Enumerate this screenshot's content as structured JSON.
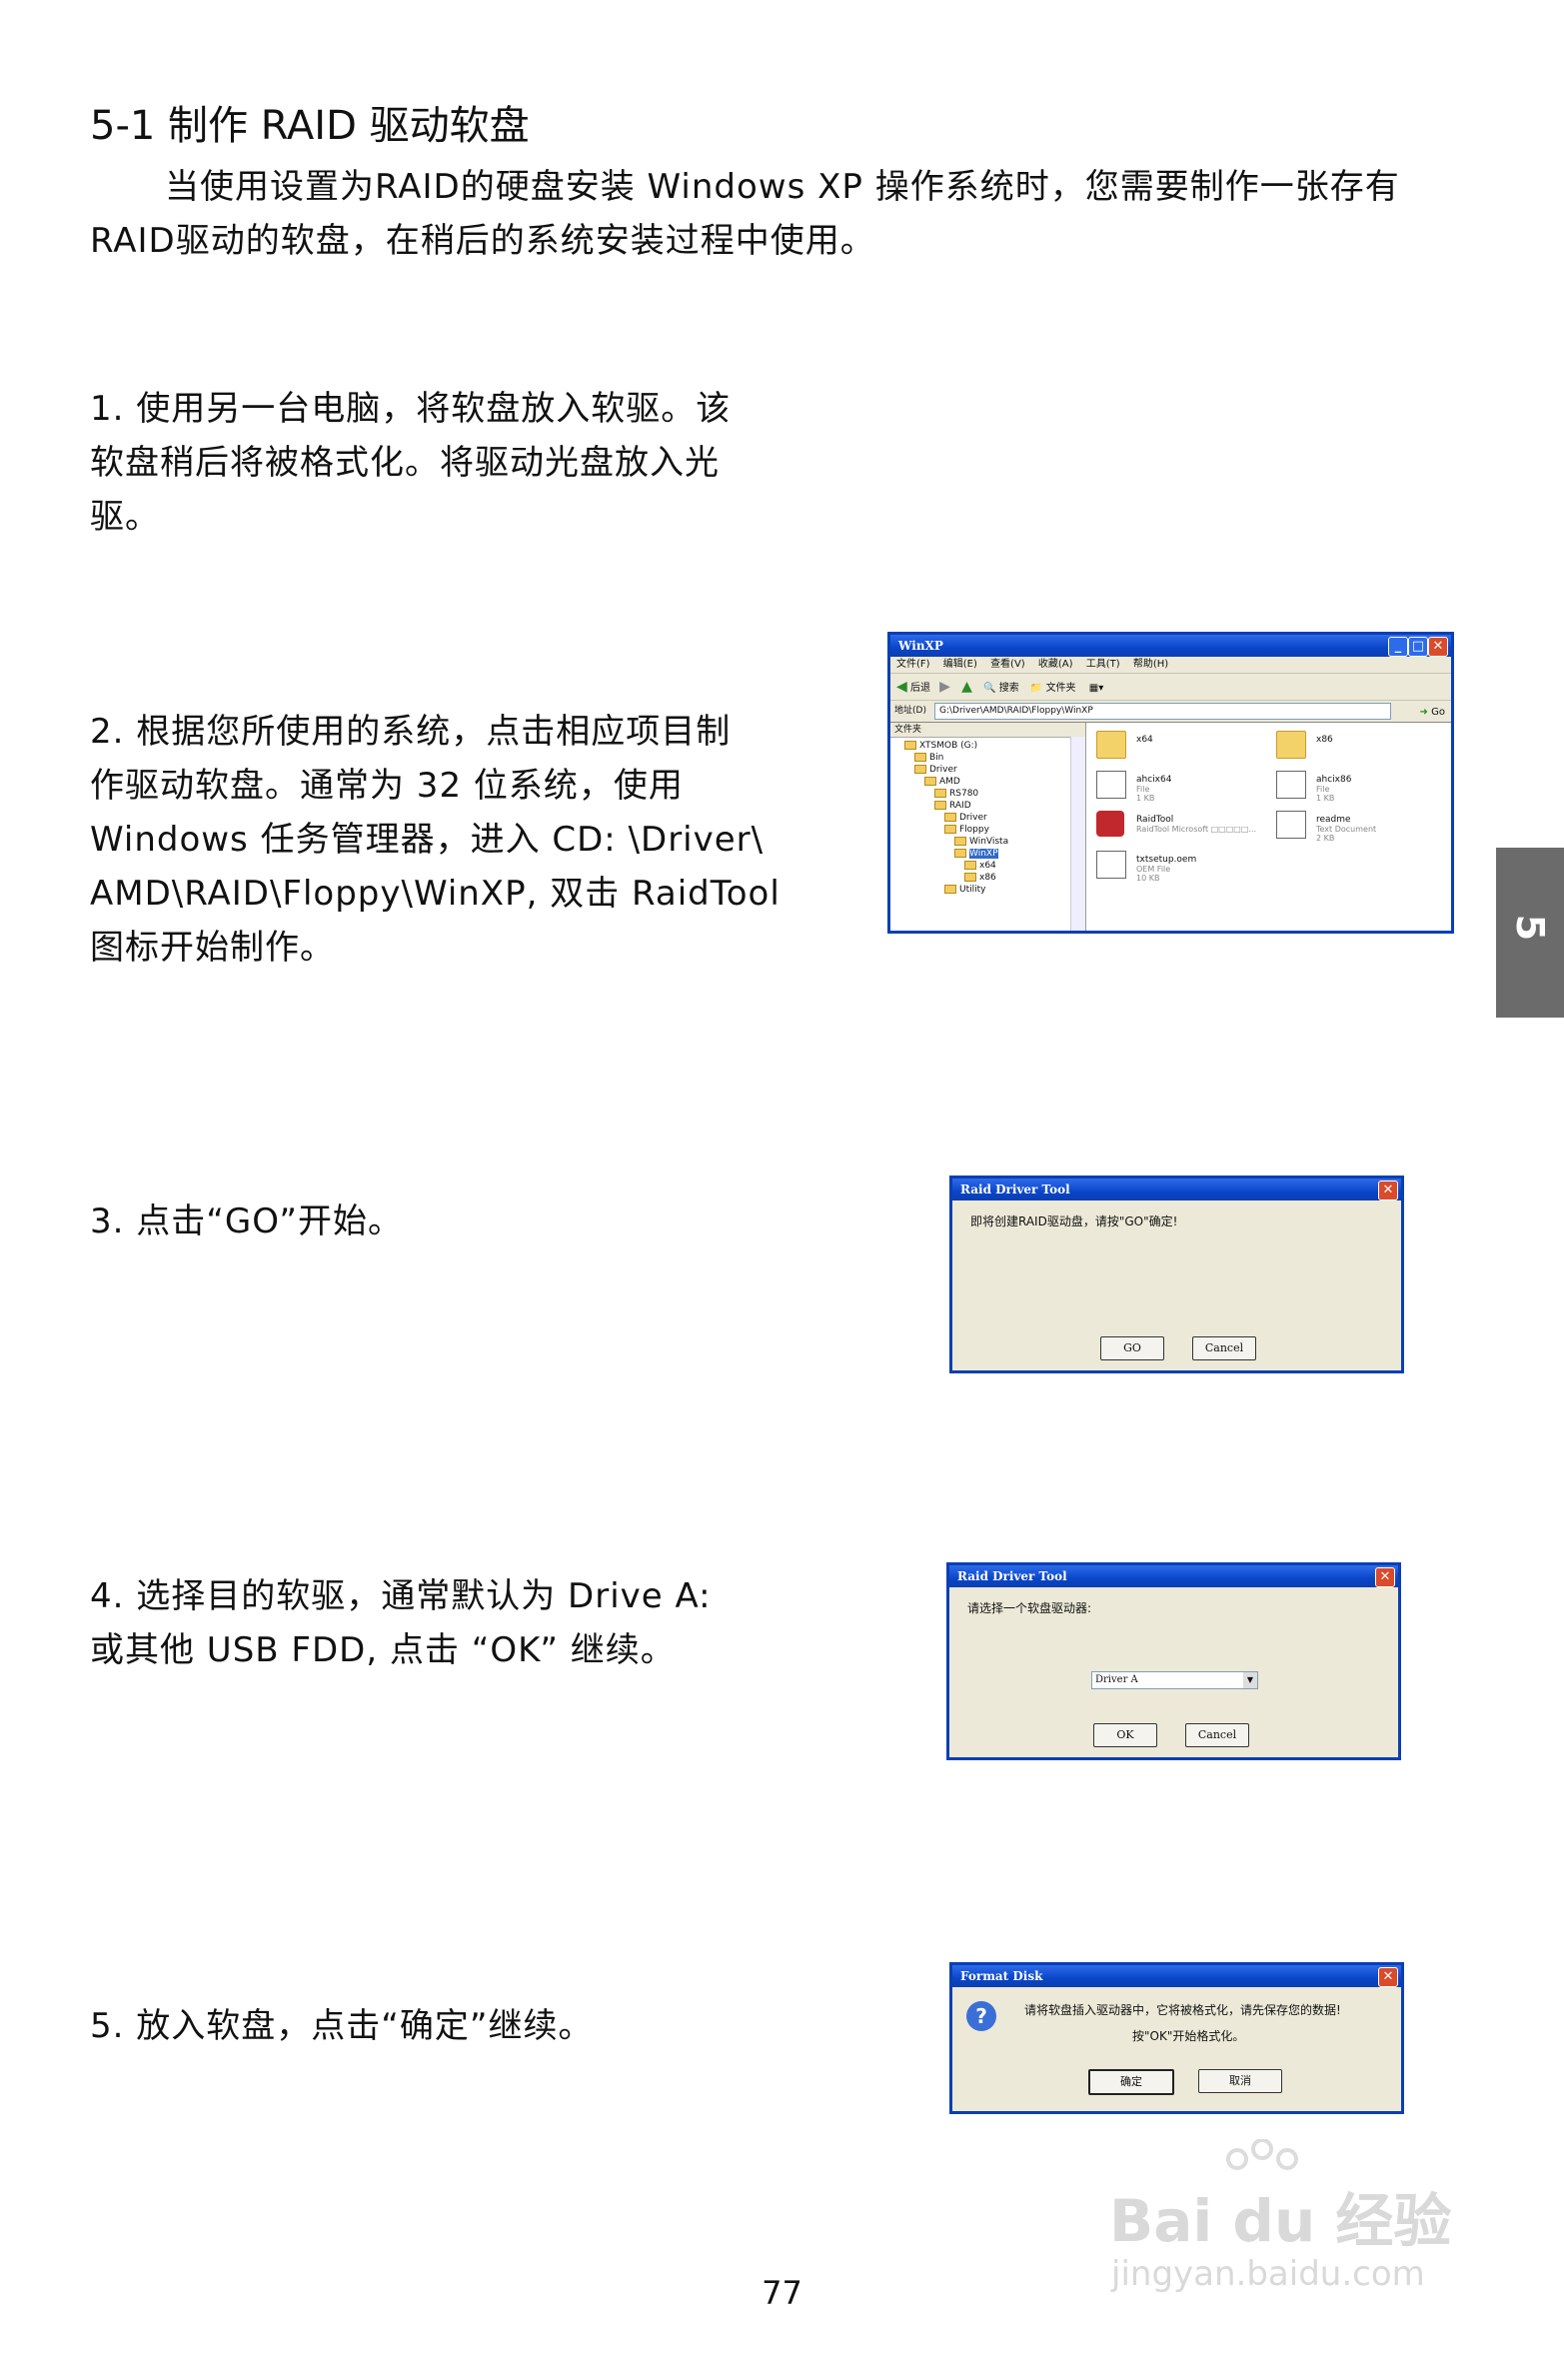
{
  "heading": "5-1 制作 RAID 驱动软盘",
  "intro": {
    "line1": "当使用设置为RAID的硬盘安装 Windows XP  操作系统时，您需要制作一张存有",
    "line2": "RAID驱动的软盘，在稍后的系统安装过程中使用。"
  },
  "steps": [
    {
      "lines": [
        "1.  使用另一台电脑，将软盘放入软驱。该",
        "软盘稍后将被格式化。将驱动光盘放入光",
        "驱。"
      ]
    },
    {
      "lines": [
        "2. 根据您所使用的系统，点击相应项目制",
        "作驱动软盘。通常为  32  位系统，使用",
        "Windows  任务管理器，进入  CD: \\Driver\\",
        "AMD\\RAID\\Floppy\\WinXP, 双击  RaidTool",
        "图标开始制作。"
      ]
    },
    {
      "lines": [
        "3. 点击“GO”开始。"
      ]
    },
    {
      "lines": [
        "4.  选择目的软驱，通常默认为  Drive  A:",
        "或其他  USB  FDD, 点击  “OK”  继续。"
      ]
    },
    {
      "lines": [
        "5. 放入软盘，点击“确定”继续。"
      ]
    }
  ],
  "side_tab": "5",
  "page_number": "77",
  "explorer": {
    "title": "WinXP",
    "menu": [
      "文件(F)",
      "编辑(E)",
      "查看(V)",
      "收藏(A)",
      "工具(T)",
      "帮助(H)"
    ],
    "toolbar": [
      "后退",
      "搜索",
      "文件夹"
    ],
    "address_label": "地址(D)",
    "address": "G:\\Driver\\AMD\\RAID\\Floppy\\WinXP",
    "go": "Go",
    "tree_header": "文件夹",
    "tree": [
      "XTSMOB (G:)",
      "Bin",
      "Driver",
      "AMD",
      "RS780",
      "RAID",
      "Driver",
      "Floppy",
      "WinVista",
      "WinXP",
      "x64",
      "x86",
      "Utility"
    ],
    "files": [
      {
        "name": "x64",
        "sub": ""
      },
      {
        "name": "x86",
        "sub": ""
      },
      {
        "name": "ahcix64",
        "sub": "File|1 KB"
      },
      {
        "name": "ahcix86",
        "sub": "File|1 KB"
      },
      {
        "name": "RaidTool",
        "sub": "RaidTool Microsoft □□□□□..."
      },
      {
        "name": "readme",
        "sub": "Text Document|2 KB"
      },
      {
        "name": "txtsetup.oem",
        "sub": "OEM File|10 KB"
      }
    ]
  },
  "dialog_go": {
    "title": "Raid Driver Tool",
    "message": "即将创建RAID驱动盘，请按\"GO\"确定!",
    "go": "GO",
    "cancel": "Cancel"
  },
  "dialog_drive": {
    "title": "Raid Driver Tool",
    "message": "请选择一个软盘驱动器:",
    "selected": "Driver A",
    "ok": "OK",
    "cancel": "Cancel"
  },
  "dialog_format": {
    "title": "Format Disk",
    "line1": "请将软盘插入驱动器中，它将被格式化，请先保存您的数据!",
    "line2": "按\"OK\"开始格式化。",
    "ok": "确定",
    "cancel": "取消"
  },
  "watermark": {
    "brand": "Bai du 经验",
    "url": "jingyan.baidu.com"
  }
}
